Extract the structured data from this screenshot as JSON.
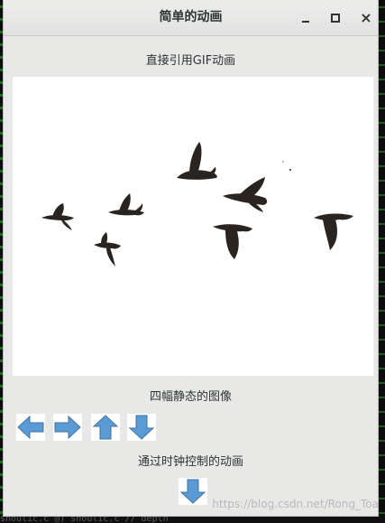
{
  "window": {
    "title": "简单的动画",
    "close_symbol": "×"
  },
  "labels": {
    "gif_caption": "直接引用GIF动画",
    "static_caption": "四幅静态的图像",
    "timer_caption": "通过时钟控制的动画"
  },
  "image": {
    "subject": "flying-birds-gif",
    "bird_color": "#2a2420"
  },
  "arrows": {
    "color": "#5b9bd5",
    "items": [
      "arrow-left-icon",
      "arrow-right-icon",
      "arrow-up-icon",
      "arrow-down-icon"
    ],
    "timer_item": "arrow-down-icon"
  },
  "watermark": "https://blog.csdn.net/Rong_Toa",
  "terminal_text": "shoulic.c     @) shoulic.c // depth"
}
